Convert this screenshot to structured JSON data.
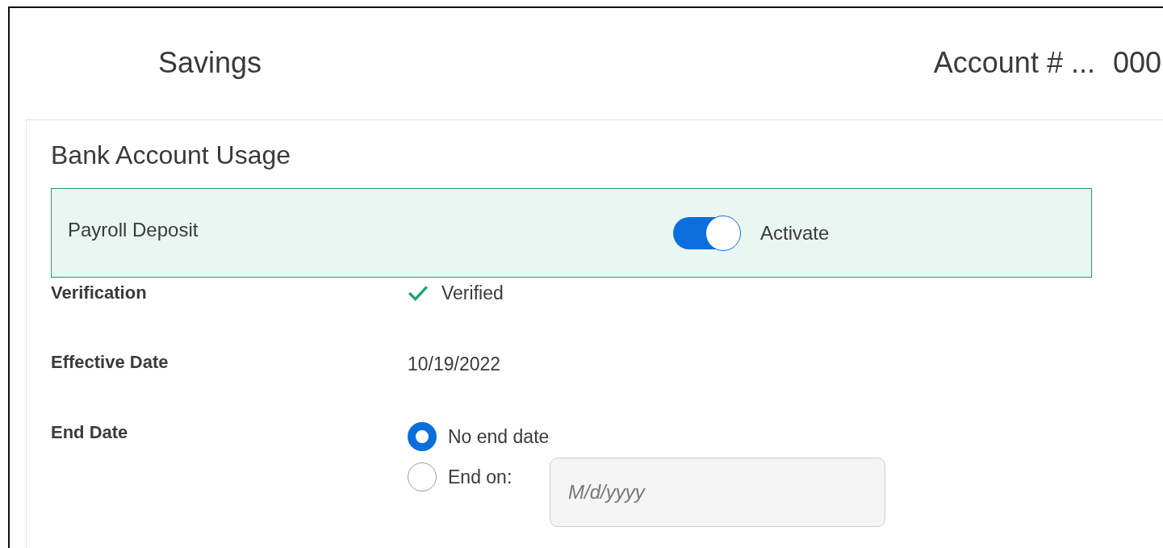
{
  "header": {
    "title": "Savings",
    "account_label": "Account # ...",
    "account_number": "000"
  },
  "section": {
    "title": "Bank Account Usage"
  },
  "usage": {
    "label": "Payroll Deposit",
    "toggle_on": true,
    "toggle_label": "Activate"
  },
  "details": [
    {
      "kind": "status",
      "label": "Verification",
      "value": "Verified",
      "verified": true
    },
    {
      "kind": "text",
      "label": "Effective Date",
      "value": "10/19/2022"
    },
    {
      "kind": "radios",
      "label": "End Date",
      "options": [
        {
          "label": "No end date",
          "selected": true
        },
        {
          "label": "End on:",
          "selected": false,
          "placeholder": "M/d/yyyy"
        }
      ]
    }
  ]
}
